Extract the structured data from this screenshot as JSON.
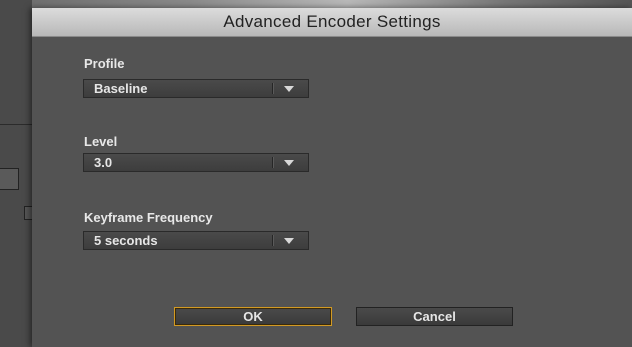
{
  "dialog": {
    "title": "Advanced Encoder Settings",
    "fields": {
      "profile": {
        "label": "Profile",
        "value": "Baseline"
      },
      "level": {
        "label": "Level",
        "value": "3.0"
      },
      "keyframe": {
        "label": "Keyframe Frequency",
        "value": "5 seconds"
      }
    },
    "buttons": {
      "ok": "OK",
      "cancel": "Cancel"
    }
  },
  "colors": {
    "dialog_bg": "#535353",
    "titlebar": "#c8c8c8",
    "default_button_border": "#d39a23"
  },
  "icons": {
    "dropdown": "chevron-down-icon"
  }
}
